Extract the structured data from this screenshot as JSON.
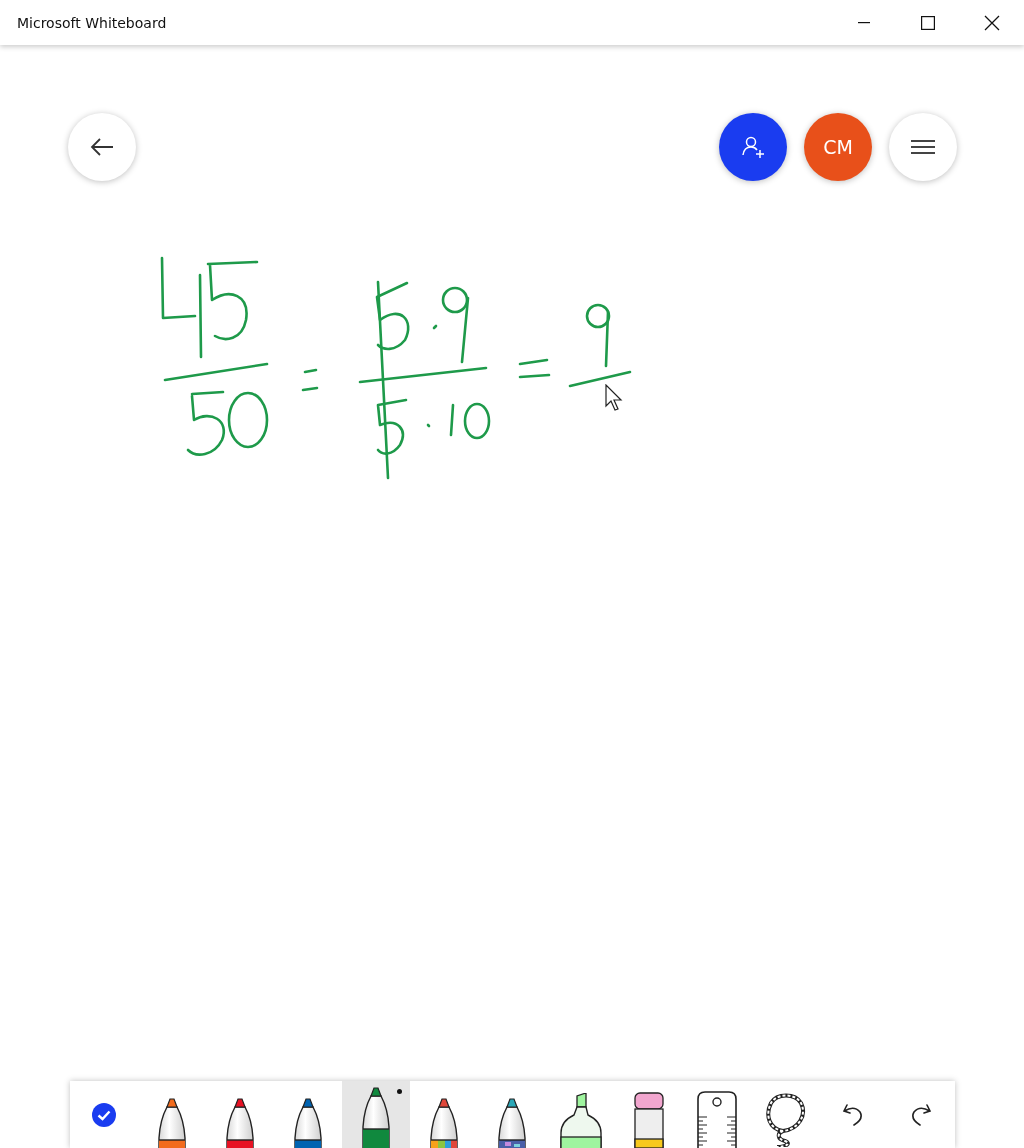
{
  "window": {
    "title": "Microsoft Whiteboard"
  },
  "header": {
    "avatar": {
      "initials": "CM"
    }
  },
  "tools": [
    {
      "kind": "done",
      "selected": false
    },
    {
      "kind": "pen",
      "color": "#f26b1d",
      "selected": false
    },
    {
      "kind": "pen",
      "color": "#e81123",
      "selected": false
    },
    {
      "kind": "pen",
      "color": "#0063b1",
      "selected": false
    },
    {
      "kind": "pen",
      "color": "#10893e",
      "selected": true
    },
    {
      "kind": "rainbow-pen",
      "color": "#e0473a",
      "selected": false
    },
    {
      "kind": "galaxy-pen",
      "color": "#2aa8b8",
      "selected": false
    },
    {
      "kind": "highlighter",
      "color": "#9ff59f",
      "selected": false
    },
    {
      "kind": "eraser",
      "selected": false
    },
    {
      "kind": "ruler",
      "selected": false
    },
    {
      "kind": "lasso",
      "selected": false
    },
    {
      "kind": "undo",
      "selected": false
    },
    {
      "kind": "redo",
      "selected": false
    }
  ]
}
